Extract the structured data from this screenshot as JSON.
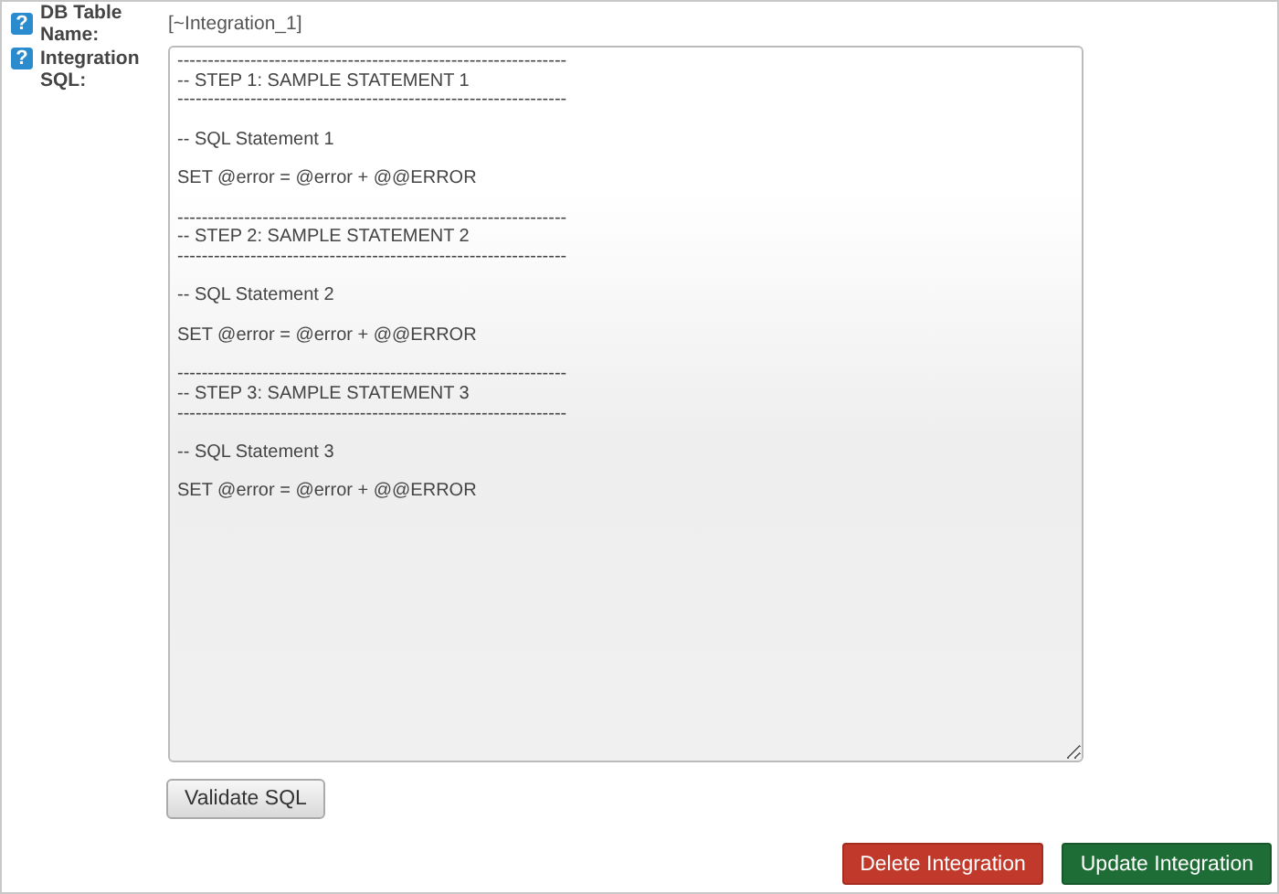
{
  "fields": [
    {
      "label": "DB Table Name:",
      "help": "?",
      "value": "[~Integration_1]"
    },
    {
      "label": "Integration SQL:",
      "help": "?"
    }
  ],
  "sql": {
    "value": "----------------------------------------------------------------\n-- STEP 1: SAMPLE STATEMENT 1\n----------------------------------------------------------------\n\n-- SQL Statement 1\n\nSET @error = @error + @@ERROR\n\n----------------------------------------------------------------\n-- STEP 2: SAMPLE STATEMENT 2\n----------------------------------------------------------------\n\n-- SQL Statement 2\n\nSET @error = @error + @@ERROR\n\n----------------------------------------------------------------\n-- STEP 3: SAMPLE STATEMENT 3\n----------------------------------------------------------------\n\n-- SQL Statement 3\n\nSET @error = @error + @@ERROR"
  },
  "validate_button": "Validate SQL",
  "actions": [
    {
      "label": "Delete Integration",
      "kind": "danger"
    },
    {
      "label": "Update Integration",
      "kind": "primary"
    }
  ]
}
